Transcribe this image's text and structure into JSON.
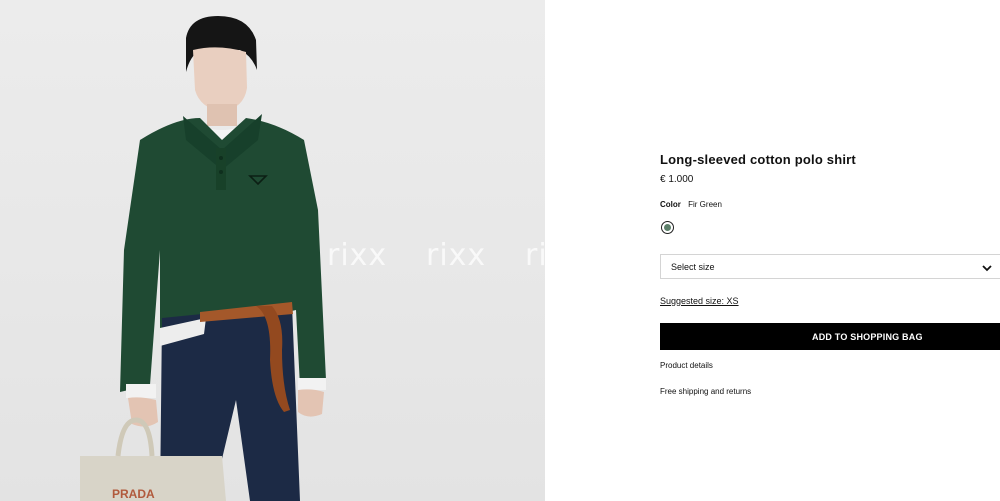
{
  "watermark": {
    "text": "rixx"
  },
  "product": {
    "title": "Long-sleeved cotton polo shirt",
    "price": "€ 1.000",
    "color_label": "Color",
    "color_value": "Fir Green",
    "swatch_color": "#5c7f6a"
  },
  "size": {
    "placeholder": "Select size",
    "chevron_icon": "chevron-down-icon"
  },
  "suggested_size": "Suggested size: XS",
  "cta": {
    "add_to_bag": "ADD TO SHOPPING BAG"
  },
  "links": {
    "product_details": "Product details",
    "shipping": "Free shipping and returns"
  },
  "colors": {
    "background_left": "#ececec",
    "shirt_green": "#1f4a33",
    "jeans": "#1c2a45",
    "belt": "#a4582a",
    "button_black": "#000000"
  }
}
